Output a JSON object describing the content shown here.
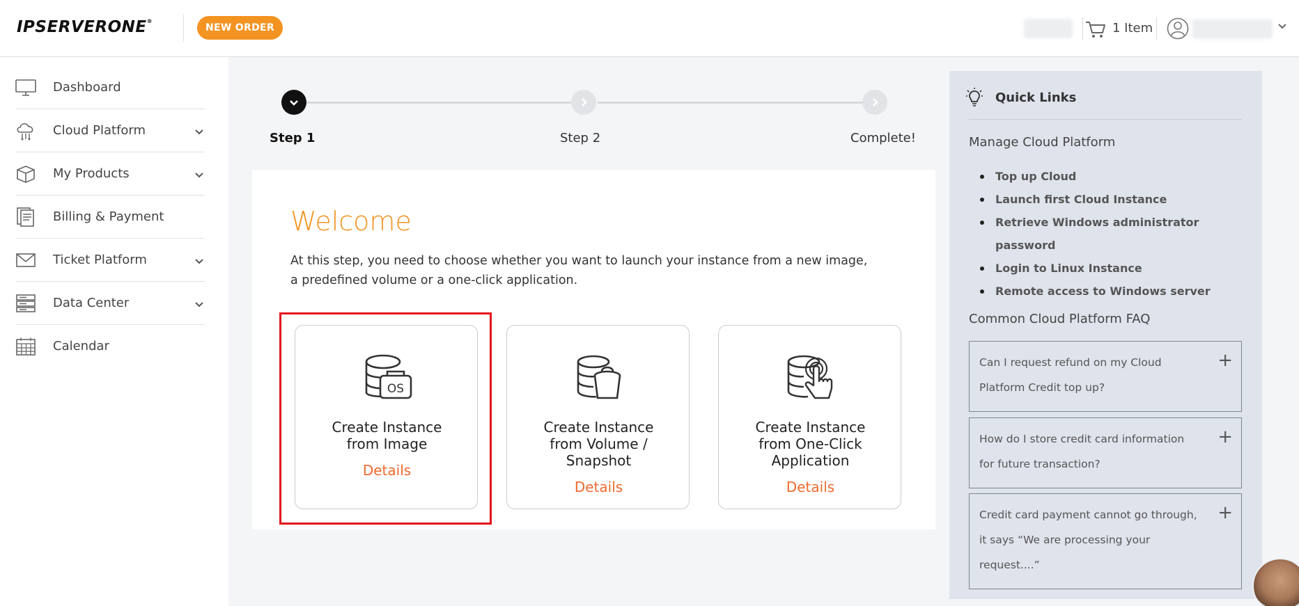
{
  "header": {
    "logo_text": "IPSERVERONE",
    "logo_mark": "®",
    "new_order_label": "NEW ORDER",
    "cart_label": "1 Item"
  },
  "sidebar": {
    "items": [
      {
        "label": "Dashboard",
        "icon": "monitor-icon",
        "has_submenu": false
      },
      {
        "label": "Cloud Platform",
        "icon": "cloud-icon",
        "has_submenu": true
      },
      {
        "label": "My Products",
        "icon": "box-icon",
        "has_submenu": true
      },
      {
        "label": "Billing & Payment",
        "icon": "invoice-icon",
        "has_submenu": false
      },
      {
        "label": "Ticket Platform",
        "icon": "envelope-icon",
        "has_submenu": true
      },
      {
        "label": "Data Center",
        "icon": "server-icon",
        "has_submenu": true
      },
      {
        "label": "Calendar",
        "icon": "calendar-icon",
        "has_submenu": false
      }
    ]
  },
  "stepper": {
    "steps": [
      {
        "label": "Step 1",
        "state": "active"
      },
      {
        "label": "Step 2",
        "state": "pending"
      },
      {
        "label": "Complete!",
        "state": "pending"
      }
    ]
  },
  "main": {
    "welcome_title": "Welcome",
    "intro_text": "At this step, you need to choose whether you want to launch your instance from a new image, a predefined volume or a one-click application.",
    "cards": [
      {
        "title_line1": "Create Instance",
        "title_line2": "from Image",
        "title_line3": "",
        "details_label": "Details",
        "icon": "database-os-icon",
        "selected": true
      },
      {
        "title_line1": "Create Instance",
        "title_line2": "from Volume /",
        "title_line3": "Snapshot",
        "details_label": "Details",
        "icon": "database-bucket-icon",
        "selected": false
      },
      {
        "title_line1": "Create Instance",
        "title_line2": "from One-Click",
        "title_line3": "Application",
        "details_label": "Details",
        "icon": "database-click-icon",
        "selected": false
      }
    ]
  },
  "quick_links": {
    "title": "Quick Links",
    "manage_heading": "Manage Cloud Platform",
    "links": [
      "Top up Cloud",
      "Launch first Cloud Instance",
      "Retrieve Windows administrator password",
      "Login to Linux Instance",
      "Remote access to Windows server"
    ],
    "faq_heading": "Common Cloud Platform FAQ",
    "faqs": [
      {
        "question": "Can I request refund on my Cloud Platform Credit top up?",
        "toggle": "+"
      },
      {
        "question": "How do I store credit card information for future transaction?",
        "toggle": "+"
      },
      {
        "question": "Credit card payment cannot go through, it says “We are processing your request....”",
        "toggle": "+"
      }
    ]
  },
  "colors": {
    "accent_orange": "#f39321",
    "details_orange": "#ee6a2e",
    "highlight_red": "#e3141b",
    "quick_links_bg": "#dfe3ec"
  }
}
